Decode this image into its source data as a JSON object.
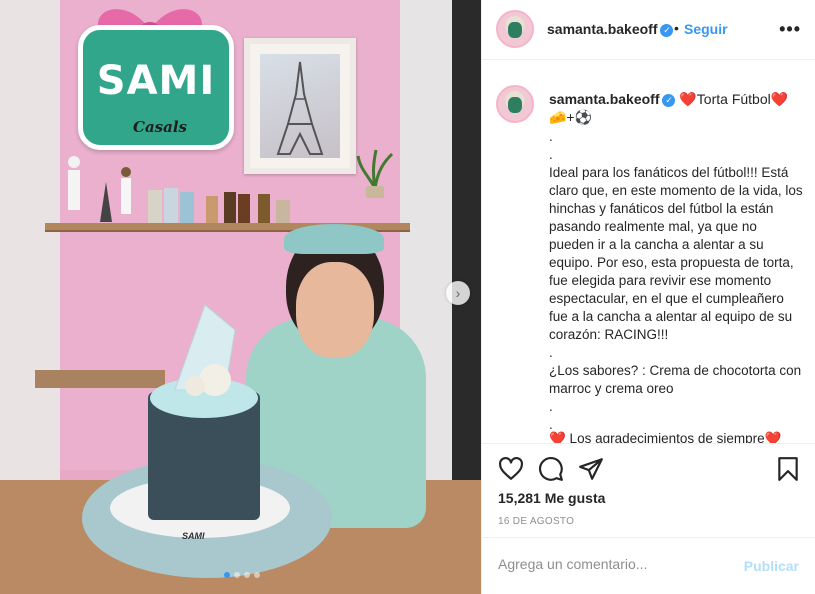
{
  "post": {
    "username": "samanta.bakeoff",
    "follow_label": "Seguir",
    "more_label": "•••",
    "separator": "•",
    "verified_mark": "✓"
  },
  "caption": {
    "username": "samanta.bakeoff",
    "title": "❤️Torta Fútbol❤️",
    "emoji_line": "🧀+⚽",
    "lines": [
      ".",
      ".",
      "Ideal para los fanáticos del fútbol!!! Está claro que, en este momento de la vida, los hinchas y fanáticos del fútbol la están pasando realmente mal, ya que no pueden ir a la cancha a alentar a su equipo. Por eso, esta propuesta de torta, fue elegida para revivir ese momento espectacular, en el que el cumpleañero fue a la cancha a alentar al equipo de su corazón: RACING!!!",
      ".",
      "¿Los sabores? : Crema de chocotorta con marroc y crema oreo",
      ".",
      "."
    ],
    "cut_line": "❤️ Los agradecimientos de siempre❤️"
  },
  "photo": {
    "logo_text": "SAMI",
    "logo_subtext": "Casals",
    "cake_label": "SAMI",
    "carousel_count": 4,
    "carousel_active": 0
  },
  "icons": {
    "like": "heart-icon",
    "comment": "comment-icon",
    "share": "share-icon",
    "save": "bookmark-icon",
    "next": "chevron-right-icon"
  },
  "stats": {
    "likes": "15,281 Me gusta",
    "date": "16 DE AGOSTO"
  },
  "comment_box": {
    "placeholder": "Agrega un comentario...",
    "publish_label": "Publicar"
  },
  "colors": {
    "link": "#3897f0",
    "publish_disabled": "#b2dffc",
    "meta_gray": "#8e8e8e",
    "border": "#efefef"
  }
}
